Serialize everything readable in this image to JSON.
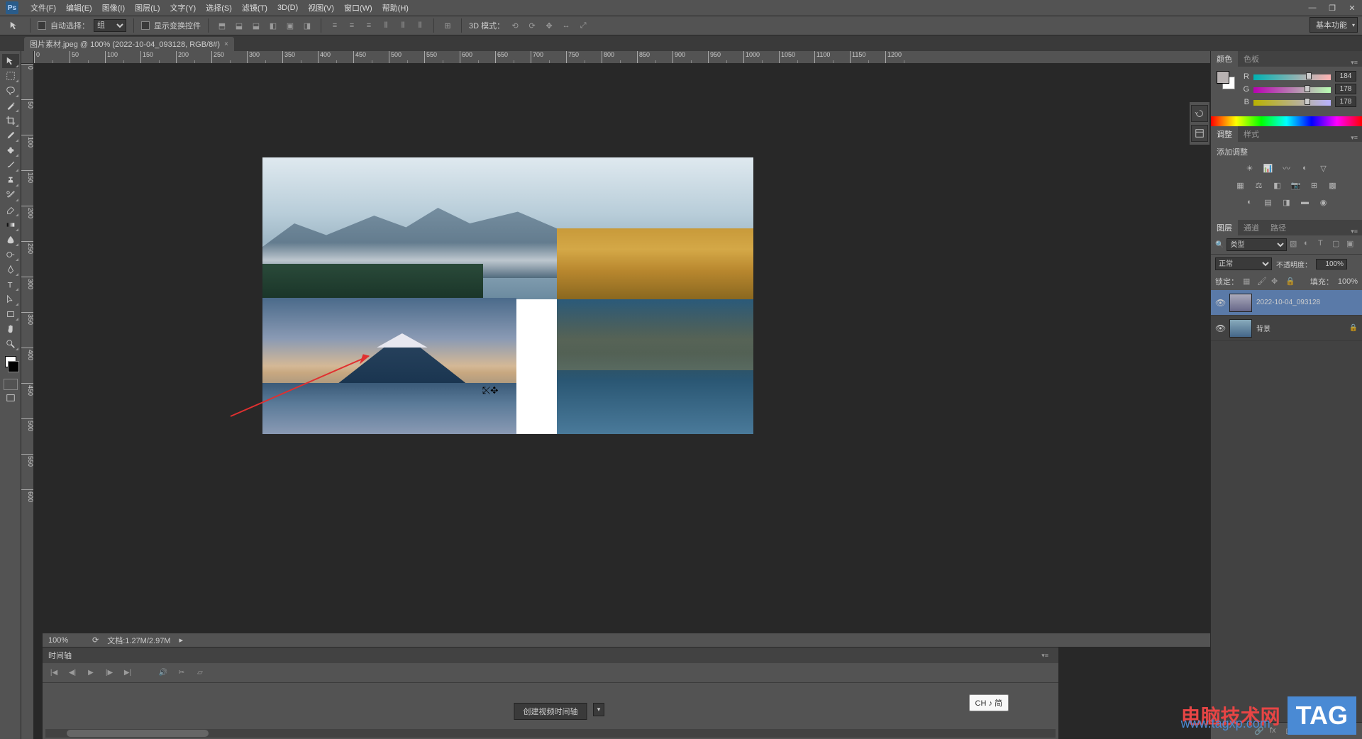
{
  "app": {
    "logo": "Ps"
  },
  "menu": {
    "file": "文件(F)",
    "edit": "编辑(E)",
    "image": "图像(I)",
    "layer": "图层(L)",
    "type": "文字(Y)",
    "select": "选择(S)",
    "filter": "滤镜(T)",
    "threeD": "3D(D)",
    "view": "视图(V)",
    "window": "窗口(W)",
    "help": "帮助(H)"
  },
  "options": {
    "autoSelectLabel": "自动选择：",
    "autoSelectMode": "组",
    "showTransformLabel": "显示变换控件",
    "threeDMode": "3D 模式："
  },
  "workspace": {
    "name": "基本功能"
  },
  "document": {
    "tabTitle": "图片素材.jpeg @ 100% (2022-10-04_093128, RGB/8#)",
    "zoom": "100%",
    "docInfo": "文档:1.27M/2.97M"
  },
  "ruler": {
    "h": [
      "0",
      "50",
      "100",
      "150",
      "200",
      "250",
      "300",
      "350",
      "400",
      "450",
      "500",
      "550",
      "600",
      "650",
      "700",
      "750",
      "800",
      "850",
      "900",
      "950",
      "1000",
      "1050",
      "1100",
      "1150",
      "1200"
    ],
    "v": [
      "0",
      "50",
      "100",
      "150",
      "200",
      "250",
      "300",
      "350",
      "400",
      "450",
      "500",
      "550",
      "600"
    ]
  },
  "panels": {
    "colorTab": "颜色",
    "swatchesTab": "色板",
    "adjustmentsTab": "调整",
    "stylesTab": "样式",
    "addAdjustment": "添加调整",
    "layersTab": "图层",
    "channelsTab": "通道",
    "pathsTab": "路径"
  },
  "color": {
    "rLabel": "R",
    "rVal": "184",
    "gLabel": "G",
    "gVal": "178",
    "bLabel": "B",
    "bVal": "178"
  },
  "layers": {
    "filterType": "类型",
    "blendMode": "正常",
    "opacityLabel": "不透明度：",
    "opacityVal": "100%",
    "lockLabel": "锁定：",
    "fillLabel": "填充：",
    "fillVal": "100%",
    "items": [
      {
        "name": "2022-10-04_093128",
        "selected": true,
        "locked": false
      },
      {
        "name": "背景",
        "selected": false,
        "locked": true
      }
    ]
  },
  "timeline": {
    "title": "时间轴",
    "createBtn": "创建视频时间轴"
  },
  "ime": {
    "text": "CH ♪ 简"
  },
  "watermark": {
    "cn": "电脑技术网",
    "url": "www.tagxp.com",
    "tag": "TAG"
  }
}
